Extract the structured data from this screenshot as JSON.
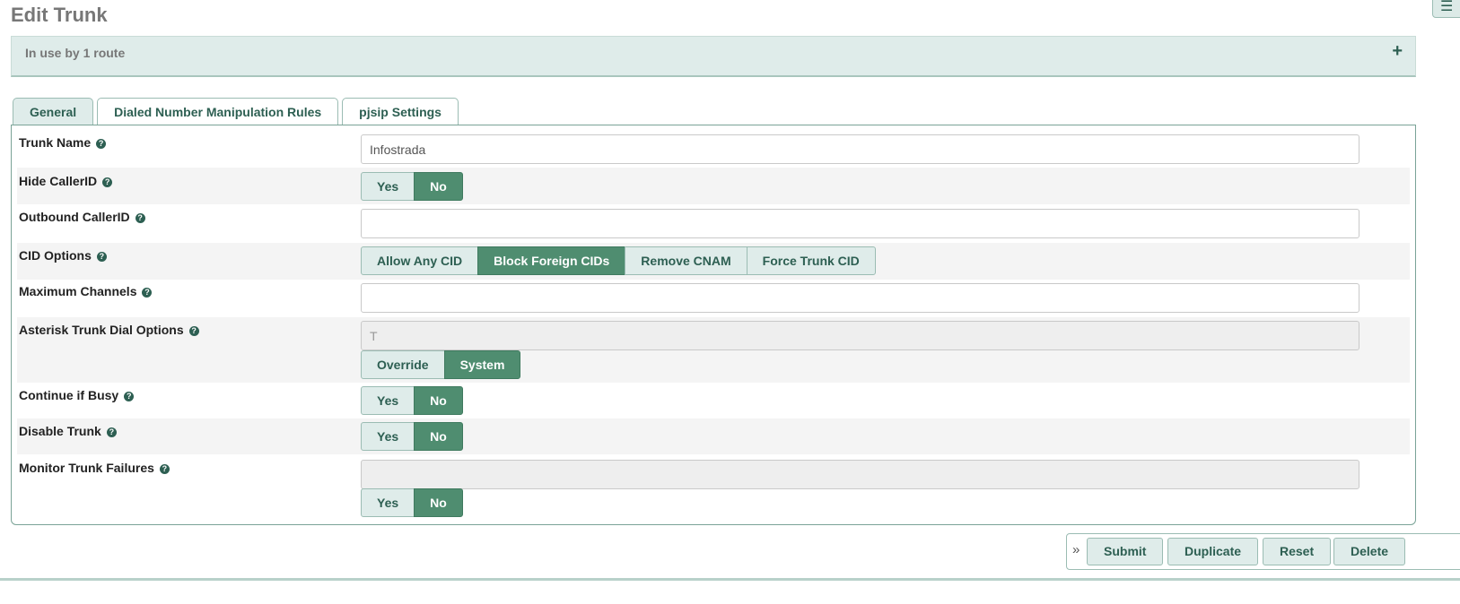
{
  "page": {
    "title": "Edit Trunk"
  },
  "usage": {
    "text": "In use by 1 route",
    "expand_symbol": "+"
  },
  "tabs": [
    {
      "label": "General",
      "active": true
    },
    {
      "label": "Dialed Number Manipulation Rules",
      "active": false
    },
    {
      "label": "pjsip Settings",
      "active": false
    }
  ],
  "form": {
    "trunk_name": {
      "label": "Trunk Name",
      "value": "Infostrada"
    },
    "hide_callerid": {
      "label": "Hide CallerID",
      "options": [
        "Yes",
        "No"
      ],
      "selected": "No"
    },
    "outbound_callerid": {
      "label": "Outbound CallerID",
      "value": ""
    },
    "cid_options": {
      "label": "CID Options",
      "options": [
        "Allow Any CID",
        "Block Foreign CIDs",
        "Remove CNAM",
        "Force Trunk CID"
      ],
      "selected": "Block Foreign CIDs"
    },
    "max_channels": {
      "label": "Maximum Channels",
      "value": ""
    },
    "dial_options": {
      "label": "Asterisk Trunk Dial Options",
      "value": "T",
      "options": [
        "Override",
        "System"
      ],
      "selected": "System"
    },
    "continue_busy": {
      "label": "Continue if Busy",
      "options": [
        "Yes",
        "No"
      ],
      "selected": "No"
    },
    "disable_trunk": {
      "label": "Disable Trunk",
      "options": [
        "Yes",
        "No"
      ],
      "selected": "No"
    },
    "monitor_failures": {
      "label": "Monitor Trunk Failures",
      "value": "",
      "options": [
        "Yes",
        "No"
      ],
      "selected": "No"
    }
  },
  "actions": {
    "submit": "Submit",
    "duplicate": "Duplicate",
    "reset": "Reset",
    "delete": "Delete",
    "collapse_symbol": "»"
  },
  "help_symbol": "?",
  "colors": {
    "accent": "#4f8d70",
    "tab_bg": "#dfecea",
    "border": "#9bbcb3"
  }
}
